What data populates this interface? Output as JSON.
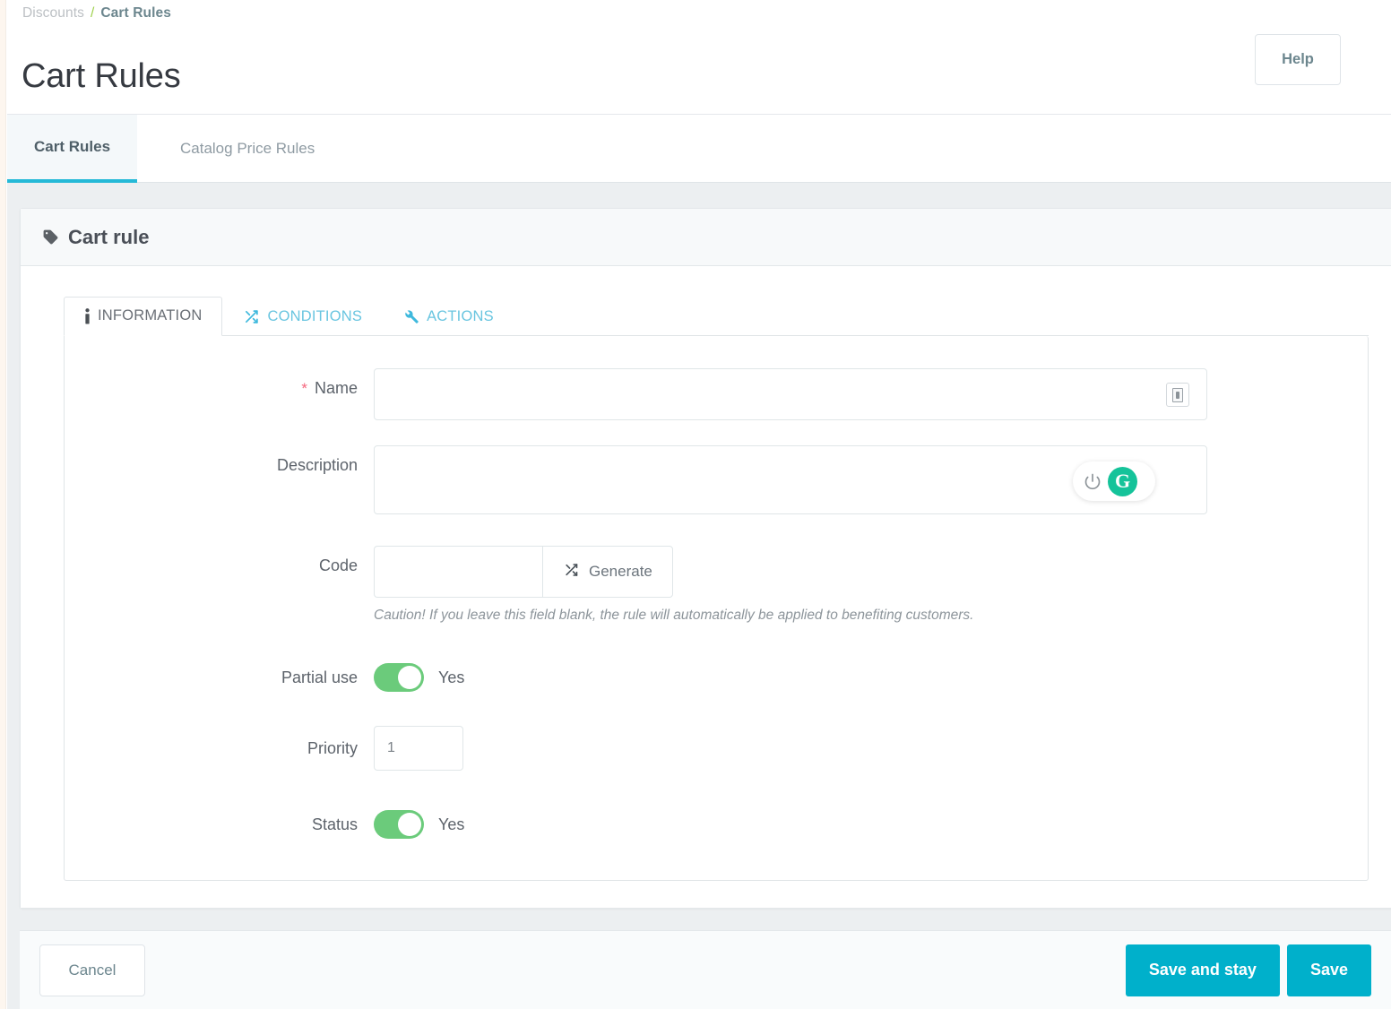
{
  "breadcrumb": {
    "parent": "Discounts",
    "separator": "/",
    "current": "Cart Rules"
  },
  "header": {
    "title": "Cart Rules",
    "help_label": "Help"
  },
  "top_tabs": [
    {
      "label": "Cart Rules",
      "active": true
    },
    {
      "label": "Catalog Price Rules",
      "active": false
    }
  ],
  "panel": {
    "title": "Cart rule",
    "icon": "tag-icon"
  },
  "inner_tabs": [
    {
      "label": "INFORMATION",
      "icon": "info-icon",
      "active": true
    },
    {
      "label": "CONDITIONS",
      "icon": "shuffle-icon",
      "active": false
    },
    {
      "label": "ACTIONS",
      "icon": "wrench-icon",
      "active": false
    }
  ],
  "form": {
    "name": {
      "label": "Name",
      "required_marker": "*",
      "value": "",
      "placeholder": "",
      "lang_icon": "language-flag-icon"
    },
    "description": {
      "label": "Description",
      "value": "",
      "placeholder": "",
      "grammarly": {
        "power_icon": "power-icon",
        "logo_letter": "G",
        "logo_color": "#15c39a"
      }
    },
    "code": {
      "label": "Code",
      "value": "",
      "placeholder": "",
      "generate_label": "Generate",
      "generate_icon": "shuffle-icon",
      "hint": "Caution! If you leave this field blank, the rule will automatically be applied to benefiting customers."
    },
    "partial_use": {
      "label": "Partial use",
      "state_label": "Yes",
      "enabled": true
    },
    "priority": {
      "label": "Priority",
      "value": "1"
    },
    "status": {
      "label": "Status",
      "state_label": "Yes",
      "enabled": true
    }
  },
  "footer": {
    "cancel_label": "Cancel",
    "save_and_stay_label": "Save and stay",
    "save_label": "Save"
  },
  "colors": {
    "accent": "#00b0cb",
    "tab_underline": "#25b9d7",
    "toggle_on": "#6bcb7b",
    "required": "#f5667d",
    "breadcrumb_separator": "#9dd04a",
    "grammarly_green": "#15c39a"
  }
}
